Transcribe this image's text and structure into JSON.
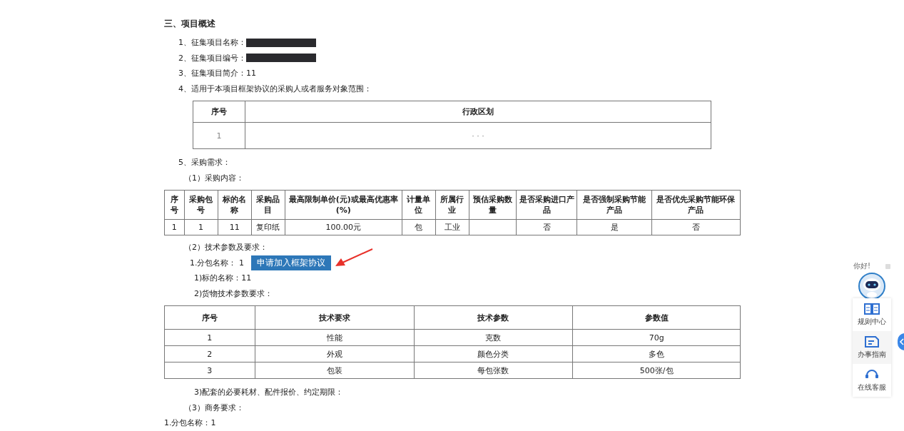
{
  "section_heading": "三、项目概述",
  "overview_items": [
    {
      "label": "1、征集项目名称：",
      "redacted": true
    },
    {
      "label": "2、征集项目编号：",
      "redacted": true
    },
    {
      "label": "3、征集项目简介：11",
      "redacted": false
    },
    {
      "label": "4、适用于本项目框架协议的采购人或者服务对象范围：",
      "redacted": false
    }
  ],
  "region_table": {
    "columns": [
      "序号",
      "行政区划"
    ],
    "rows": [
      [
        "1",
        "· · ·"
      ]
    ]
  },
  "requirement_heading": "5、采购需求：",
  "content_heading": "（1）采购内容：",
  "purchase_table": {
    "columns": [
      "序号",
      "采购包号",
      "标的名称",
      "采购品目",
      "最高限制单价(元)或最高优惠率(%)",
      "计量单位",
      "所属行业",
      "预估采购数量",
      "是否采购进口产品",
      "是否强制采购节能产品",
      "是否优先采购节能环保产品"
    ],
    "rows": [
      [
        "1",
        "1",
        "11",
        "复印纸",
        "100.00元",
        "包",
        "工业",
        "",
        "否",
        "是",
        "否"
      ]
    ]
  },
  "tech_heading": "（2）技术参数及要求：",
  "package_label": "1.分包名称：  1",
  "apply_button": "申请加入框架协议",
  "subject_name": "1)标的名称：11",
  "goods_heading": "2)货物技术参数要求：",
  "tech_table": {
    "columns": [
      "序号",
      "技术要求",
      "技术参数",
      "参数值"
    ],
    "rows": [
      [
        "1",
        "性能",
        "克数",
        "70g"
      ],
      [
        "2",
        "外观",
        "颜色分类",
        "多色"
      ],
      [
        "3",
        "包装",
        "每包张数",
        "500张/包"
      ]
    ]
  },
  "consumables_heading": "3)配套的必要耗材、配件报价、约定期限：",
  "business_heading": "（3）商务要求：",
  "business_package": "1.分包名称：1",
  "assistant": {
    "greeting": "你好!",
    "items": [
      {
        "kind": "book",
        "label": "规则中心"
      },
      {
        "kind": "guide",
        "label": "办事指南"
      },
      {
        "kind": "headset",
        "label": "在线客服"
      }
    ]
  }
}
